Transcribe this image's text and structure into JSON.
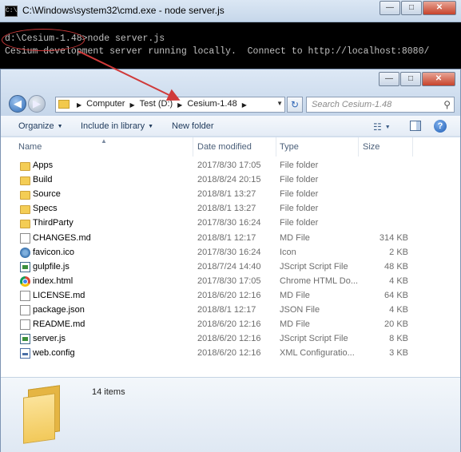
{
  "cmd": {
    "title": "C:\\Windows\\system32\\cmd.exe - node  server.js",
    "line1": "d:\\Cesium-1.48>node server.js",
    "line2": "Cesium development server running locally.  Connect to http://localhost:8080/",
    "icon_label": "C:\\"
  },
  "window_controls": {
    "minimize": "—",
    "maximize": "□",
    "close": "✕"
  },
  "explorer": {
    "breadcrumb": [
      "Computer",
      "Test (D:)",
      "Cesium-1.48"
    ],
    "search_placeholder": "Search Cesium-1.48",
    "toolbar": {
      "organize": "Organize",
      "include_in_library": "Include in library",
      "new_folder": "New folder"
    },
    "columns": {
      "name": "Name",
      "date": "Date modified",
      "type": "Type",
      "size": "Size"
    },
    "files": [
      {
        "name": "Apps",
        "date": "2017/8/30 17:05",
        "type": "File folder",
        "size": "",
        "icon": "folder-icon"
      },
      {
        "name": "Build",
        "date": "2018/8/24 20:15",
        "type": "File folder",
        "size": "",
        "icon": "folder-icon"
      },
      {
        "name": "Source",
        "date": "2018/8/1 13:27",
        "type": "File folder",
        "size": "",
        "icon": "folder-icon"
      },
      {
        "name": "Specs",
        "date": "2018/8/1 13:27",
        "type": "File folder",
        "size": "",
        "icon": "folder-icon"
      },
      {
        "name": "ThirdParty",
        "date": "2017/8/30 16:24",
        "type": "File folder",
        "size": "",
        "icon": "folder-icon"
      },
      {
        "name": "CHANGES.md",
        "date": "2018/8/1 12:17",
        "type": "MD File",
        "size": "314 KB",
        "icon": "document-icon"
      },
      {
        "name": "favicon.ico",
        "date": "2017/8/30 16:24",
        "type": "Icon",
        "size": "2 KB",
        "icon": "ico-file-icon"
      },
      {
        "name": "gulpfile.js",
        "date": "2018/7/24 14:40",
        "type": "JScript Script File",
        "size": "48 KB",
        "icon": "jscript-file-icon"
      },
      {
        "name": "index.html",
        "date": "2017/8/30 17:05",
        "type": "Chrome HTML Do...",
        "size": "4 KB",
        "icon": "chrome-html-icon"
      },
      {
        "name": "LICENSE.md",
        "date": "2018/6/20 12:16",
        "type": "MD File",
        "size": "64 KB",
        "icon": "document-icon"
      },
      {
        "name": "package.json",
        "date": "2018/8/1 12:17",
        "type": "JSON File",
        "size": "4 KB",
        "icon": "document-icon"
      },
      {
        "name": "README.md",
        "date": "2018/6/20 12:16",
        "type": "MD File",
        "size": "20 KB",
        "icon": "document-icon"
      },
      {
        "name": "server.js",
        "date": "2018/6/20 12:16",
        "type": "JScript Script File",
        "size": "8 KB",
        "icon": "jscript-file-icon"
      },
      {
        "name": "web.config",
        "date": "2018/6/20 12:16",
        "type": "XML Configuratio...",
        "size": "3 KB",
        "icon": "xml-config-icon"
      }
    ],
    "status": {
      "item_count": "14 items"
    }
  },
  "colors": {
    "annotation_red": "#d03a3a",
    "folder_yellow": "#f4cd55",
    "cmd_text": "#c0c0c0"
  }
}
